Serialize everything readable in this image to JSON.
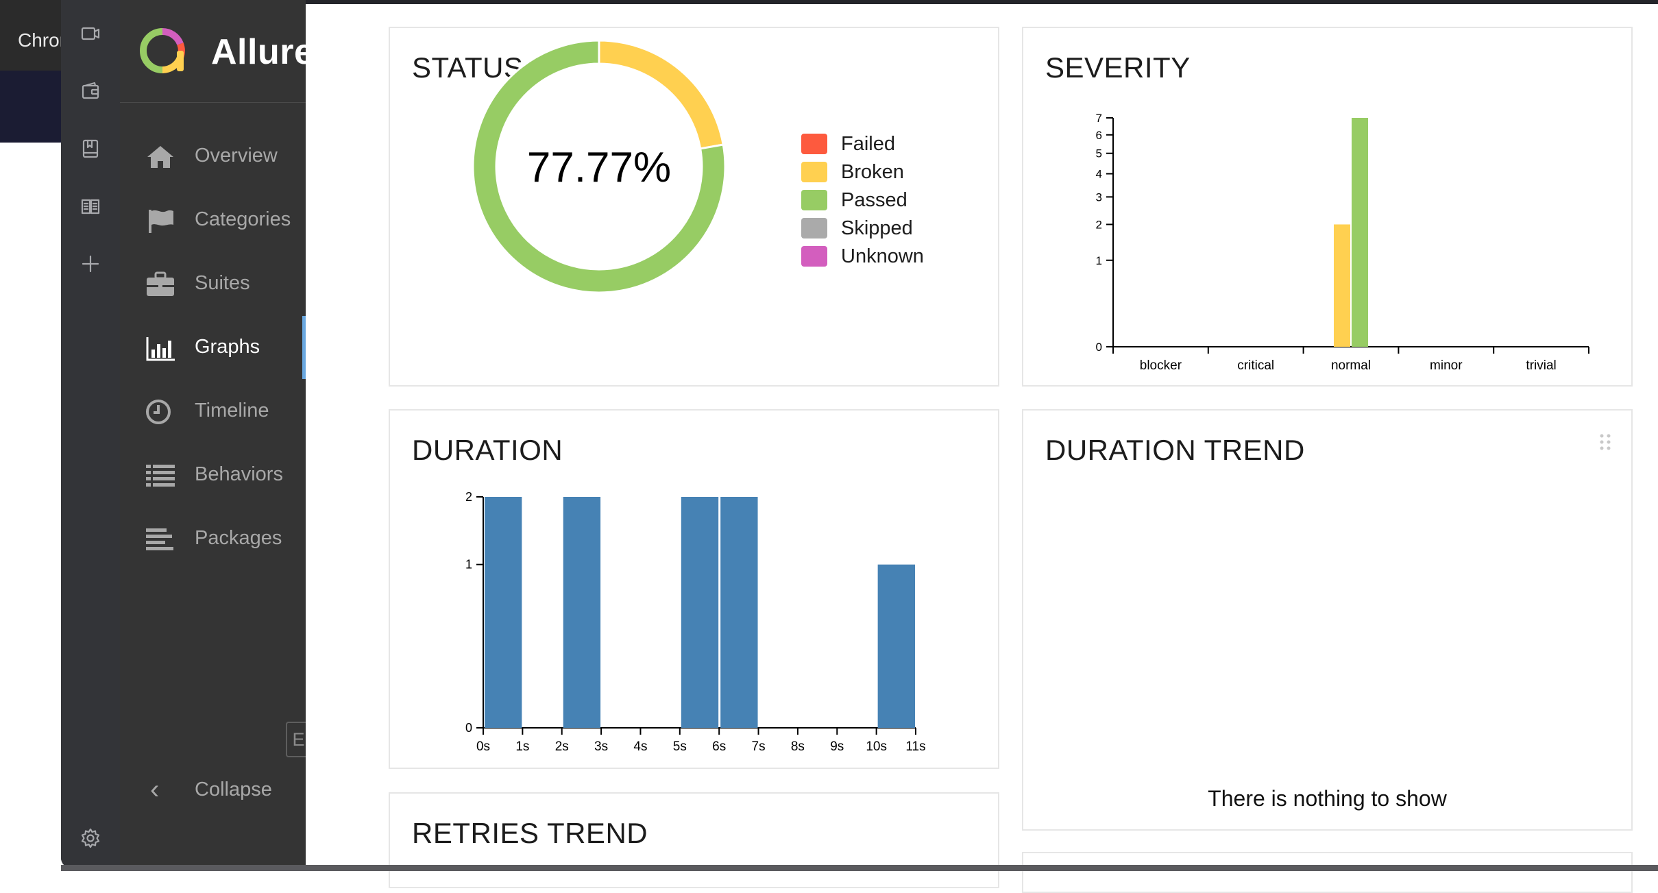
{
  "background": {
    "tab_title": "Chrome"
  },
  "brand": {
    "name": "Allure"
  },
  "nav": {
    "items": [
      {
        "label": "Overview",
        "icon": "home-icon"
      },
      {
        "label": "Categories",
        "icon": "flag-icon"
      },
      {
        "label": "Suites",
        "icon": "briefcase-icon"
      },
      {
        "label": "Graphs",
        "icon": "bar-chart-icon",
        "active": true
      },
      {
        "label": "Timeline",
        "icon": "clock-icon"
      },
      {
        "label": "Behaviors",
        "icon": "list-icon"
      },
      {
        "label": "Packages",
        "icon": "align-left-icon"
      }
    ],
    "language": "En",
    "collapse_label": "Collapse"
  },
  "widgets": {
    "status": {
      "title": "STATUS"
    },
    "severity": {
      "title": "SEVERITY"
    },
    "duration": {
      "title": "DURATION"
    },
    "duration_trend": {
      "title": "DURATION TREND",
      "empty_message": "There is nothing to show"
    },
    "retries_trend": {
      "title": "RETRIES TREND"
    }
  },
  "colors": {
    "failed": "#fd5a3e",
    "broken": "#ffd050",
    "passed": "#97cc64",
    "skipped": "#aaaaaa",
    "unknown": "#d35ebe",
    "bar": "#4682b4"
  },
  "chart_data": [
    {
      "type": "pie",
      "title": "STATUS",
      "center_label": "77.77%",
      "legend": [
        "Failed",
        "Broken",
        "Passed",
        "Skipped",
        "Unknown"
      ],
      "slices": [
        {
          "name": "Failed",
          "value": 0
        },
        {
          "name": "Broken",
          "value": 2
        },
        {
          "name": "Passed",
          "value": 7
        },
        {
          "name": "Skipped",
          "value": 0
        },
        {
          "name": "Unknown",
          "value": 0
        }
      ]
    },
    {
      "type": "bar",
      "title": "SEVERITY",
      "categories": [
        "blocker",
        "critical",
        "normal",
        "minor",
        "trivial"
      ],
      "series": [
        {
          "name": "Broken",
          "values": [
            0,
            0,
            2,
            0,
            0
          ]
        },
        {
          "name": "Passed",
          "values": [
            0,
            0,
            7,
            0,
            0
          ]
        }
      ],
      "y_scale": "sqrt",
      "y_ticks": [
        0,
        1,
        2,
        3,
        4,
        5,
        6,
        7
      ],
      "ylim": [
        0,
        7
      ]
    },
    {
      "type": "bar",
      "title": "DURATION",
      "x_ticks": [
        "0s",
        "1s",
        "2s",
        "3s",
        "4s",
        "5s",
        "6s",
        "7s",
        "8s",
        "9s",
        "10s",
        "11s"
      ],
      "bins": [
        {
          "from": 0,
          "to": 1,
          "count": 2
        },
        {
          "from": 2,
          "to": 3,
          "count": 2
        },
        {
          "from": 5,
          "to": 6,
          "count": 2
        },
        {
          "from": 6,
          "to": 7,
          "count": 2
        },
        {
          "from": 10,
          "to": 11,
          "count": 1
        }
      ],
      "y_scale": "sqrt",
      "y_ticks": [
        0,
        1,
        2
      ],
      "ylim": [
        0,
        2
      ]
    }
  ]
}
